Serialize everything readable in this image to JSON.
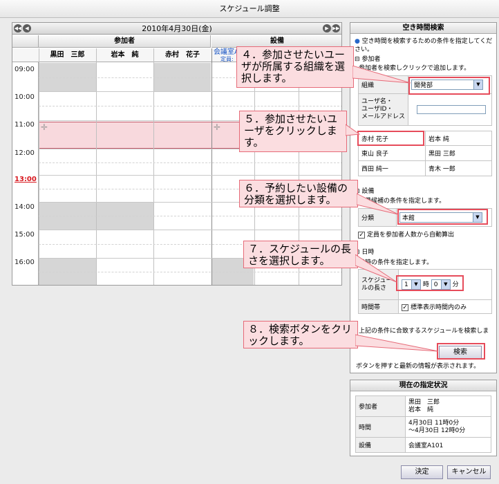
{
  "window_title": "スケジュール調整",
  "calendar": {
    "date": "2010年4月30日(金)",
    "group_participants": "参加者",
    "group_facilities": "設備",
    "participants": [
      "黒田　三郎",
      "岩本　純",
      "赤村　花子"
    ],
    "facility": "会議室A",
    "facility_sub": "定員:",
    "times": [
      "09:00",
      "10:00",
      "11:00",
      "12:00",
      "13:00",
      "14:00",
      "15:00",
      "16:00"
    ],
    "current_time": "13:00"
  },
  "search": {
    "title": "空き時間検索",
    "intro": "空き時間を検索するための条件を指定してください。",
    "participant_section": "参加者",
    "participant_hint": "参加者を検索しクリックで追加します。",
    "org_label": "組織",
    "org_value": "開発部",
    "user_label": "ユーザ名・\nユーザID・\nメールアドレス",
    "users": [
      [
        "赤村 花子",
        "岩本 純"
      ],
      [
        "東山 良子",
        "黒田 三郎"
      ],
      [
        "西田 純一",
        "青木 一郎"
      ]
    ],
    "facility_section": "設備",
    "facility_hint": "設備候補の条件を指定します。",
    "category_label": "分類",
    "category_value": "本館",
    "auto_capacity": "定員を参加者人数から自動算出",
    "datetime_section": "日時",
    "datetime_hint": "日時の条件を指定します。",
    "duration_label": "スケジュールの長さ",
    "duration_hours": "1",
    "hour_unit": "時",
    "duration_minutes": "0",
    "minute_unit": "分",
    "timeslot_label": "時間帯",
    "timeslot_check": "標準表示時間内のみ",
    "search_hint": "上記の条件に合致するスケジュールを検索します。",
    "search_button": "検索",
    "footer_hint": "ボタンを押すと最新の情報が表示されます。"
  },
  "status": {
    "title": "現在の指定状況",
    "participants_label": "参加者",
    "participants_value": "黒田　三郎\n岩本　純",
    "time_label": "時間",
    "time_value": "4月30日 11時0分\n～4月30日 12時0分",
    "facility_label": "設備",
    "facility_value": "会議室A101"
  },
  "buttons": {
    "ok": "決定",
    "cancel": "キャンセル"
  },
  "callouts": {
    "c4": "４．参加させたいユーザが所属する組織を選択します。",
    "c5": "５．参加させたいユーザをクリックします。",
    "c6": "６．予約したい設備の分類を選択します。",
    "c7": "７．スケジュールの長さを選択します。",
    "c8": "８．検索ボタンをクリックします。"
  }
}
